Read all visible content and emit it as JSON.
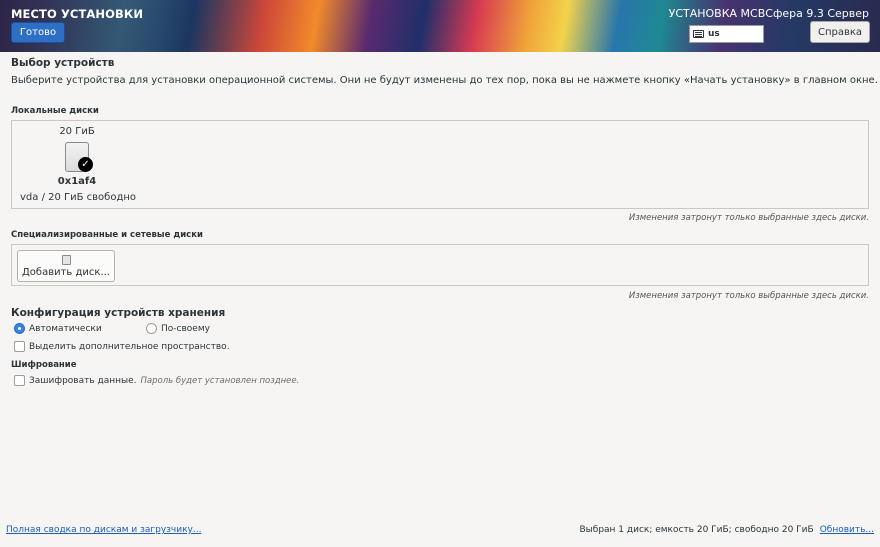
{
  "header": {
    "spoke_title": "МЕСТО УСТАНОВКИ",
    "done_label": "Готово",
    "product_title": "УСТАНОВКА МСВСфера 9.3 Сервер",
    "keyboard_layout": "us",
    "help_label": "Справка"
  },
  "device_selection": {
    "title": "Выбор устройств",
    "description": "Выберите устройства для установки операционной системы. Они не будут изменены до тех пор, пока вы не нажмете кнопку «Начать установку» в главном окне."
  },
  "local_disks": {
    "heading": "Локальные диски",
    "disks": [
      {
        "size": "20 ГиБ",
        "name": "0x1af4",
        "info": "vda  /  20 ГиБ свободно",
        "selected": true
      }
    ],
    "hint": "Изменения затронут только выбранные здесь диски."
  },
  "specialized_disks": {
    "heading": "Специализированные и сетевые диски",
    "add_disk_label": "Добавить диск...",
    "hint": "Изменения затронут только выбранные здесь диски."
  },
  "storage_config": {
    "title": "Конфигурация устройств хранения",
    "auto_label": "Автоматически",
    "custom_label": "По-своему",
    "selected": "auto",
    "reclaim_label": "Выделить дополнительное пространство."
  },
  "encryption": {
    "heading": "Шифрование",
    "encrypt_label": "Зашифровать данные.",
    "encrypt_hint": "Пароль будет установлен позднее."
  },
  "footer": {
    "summary_link": "Полная сводка по дискам и загрузчику...",
    "status": "Выбран 1 диск; емкость 20 ГиБ; свободно 20 ГиБ",
    "refresh_link": "Обновить..."
  },
  "colors": {
    "accent": "#3584e4",
    "done_button": "#2d6fc5",
    "link": "#1a5fb4"
  },
  "icons": [
    "keyboard-icon",
    "disk-icon",
    "checkmark-icon",
    "add-disk-icon"
  ]
}
